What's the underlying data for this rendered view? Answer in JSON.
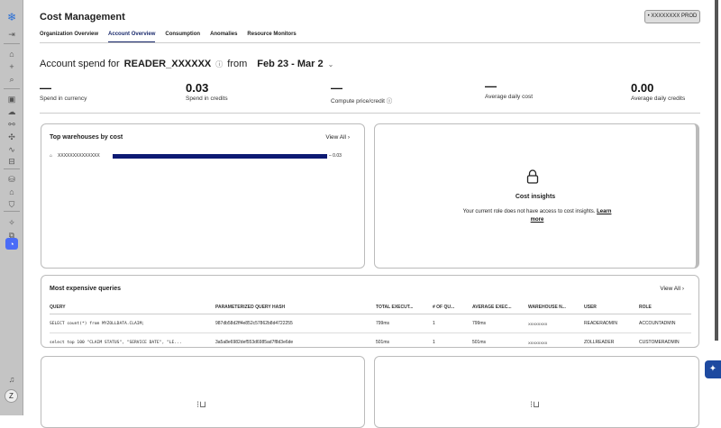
{
  "sidebar": {
    "logo": "❄",
    "avatar": "Z"
  },
  "header": {
    "title": "Cost Management",
    "account_button": "• XXXXXXXX  PROD"
  },
  "tabs": [
    "Organization Overview",
    "Account Overview",
    "Consumption",
    "Anomalies",
    "Resource Monitors"
  ],
  "spend": {
    "prefix": "Account spend for",
    "account": "READER_XXXXXX",
    "from": "from",
    "range": "Feb 23 - Mar 2"
  },
  "metrics": [
    {
      "value": "—",
      "label": "Spend in currency"
    },
    {
      "value": "0.03",
      "label": "Spend in credits"
    },
    {
      "value": "—",
      "label": "Compute price/credit"
    },
    {
      "value": "—",
      "label": "Average daily cost"
    },
    {
      "value": "0.00",
      "label": "Average daily credits"
    }
  ],
  "warehouses": {
    "title": "Top warehouses by cost",
    "view_all": "View All",
    "items": [
      {
        "name": "XXXXXXXXXXXXXX",
        "value": "0.03",
        "fraction": 1.0
      }
    ]
  },
  "insights": {
    "title": "Cost insights",
    "text": "Your current role does not have access to cost insights.",
    "link": "Learn more"
  },
  "queries": {
    "title": "Most expensive queries",
    "view_all": "View All",
    "columns": [
      "QUERY",
      "PARAMETERIZED QUERY HASH",
      "TOTAL EXECUT...",
      "# OF QU...",
      "AVERAGE EXEC...",
      "WAREHOUSE N...",
      "USER",
      "ROLE"
    ],
    "rows": [
      [
        "SELECT count(*) from MYZOLLDATA.CLAIM;",
        "987db58d2ff4e852c57862b8d4722255",
        "799ms",
        "1",
        "799ms",
        "XXXXXXXX",
        "READERADMIN",
        "ACCOUNTADMIN"
      ],
      [
        "select top 100 \"CLAIM STATUS\", \"SERVICE DATE\", \"LE...",
        "3a5a8e6982def553d6985ad7f8d3e6de",
        "501ms",
        "1",
        "501ms",
        "XXXXXXXX",
        "ZOLLREADER",
        "CUSTOMERADMIN"
      ]
    ]
  },
  "fab": "✦"
}
